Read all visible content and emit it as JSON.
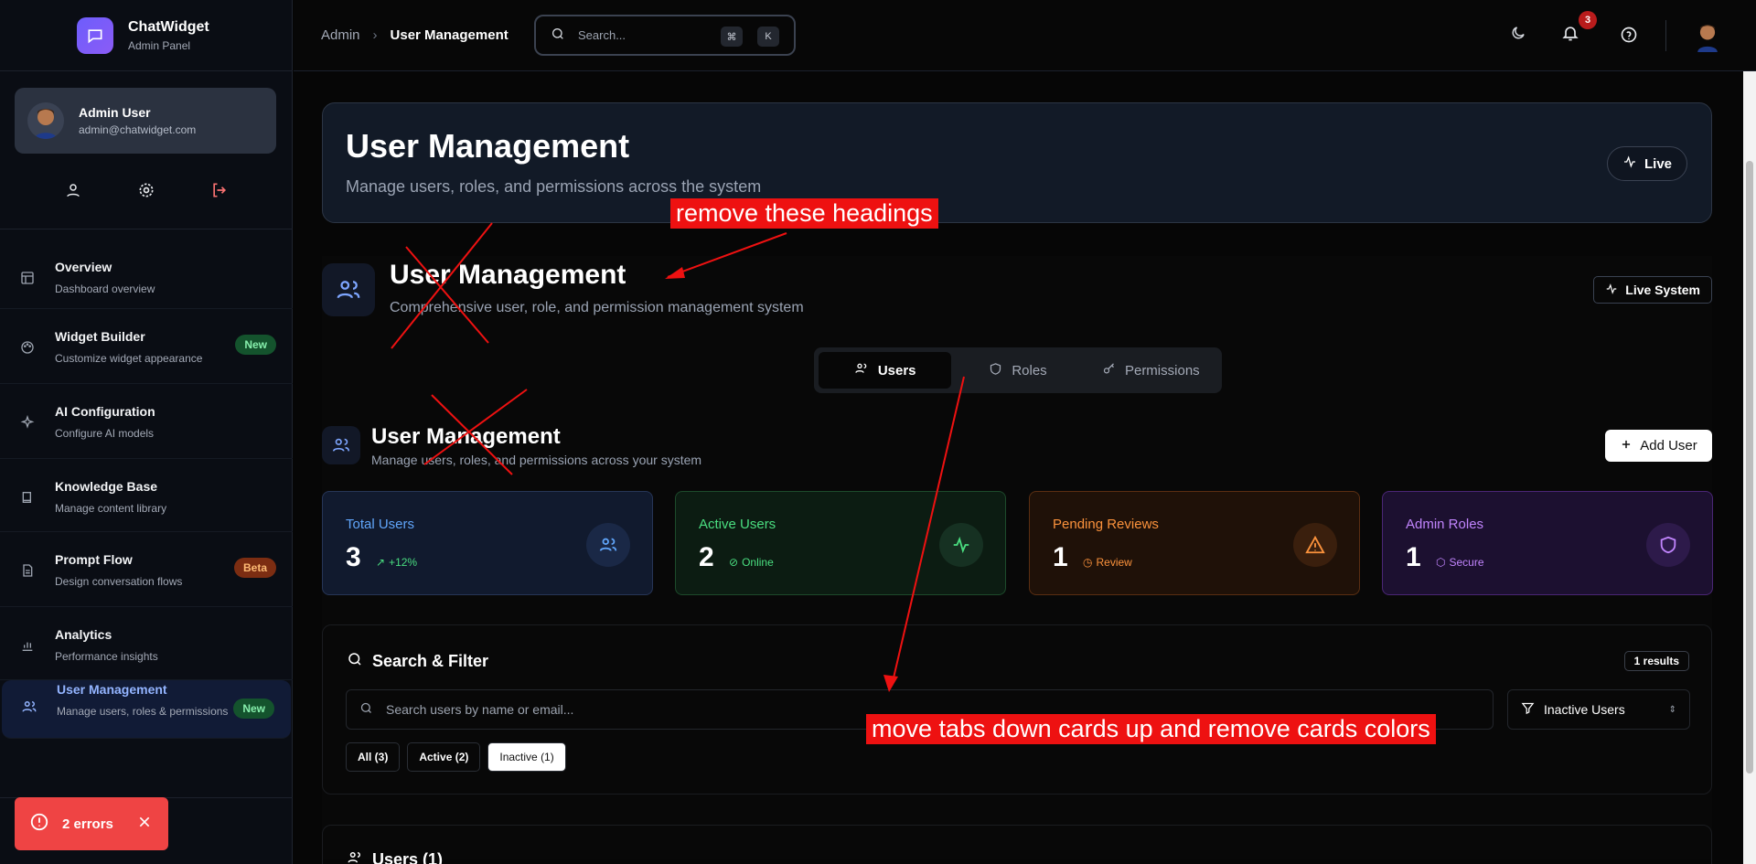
{
  "brand": {
    "name": "ChatWidget",
    "subtitle": "Admin Panel"
  },
  "user": {
    "name": "Admin User",
    "email": "admin@chatwidget.com"
  },
  "sidebar": {
    "items": [
      {
        "title": "Overview",
        "desc": "Dashboard overview",
        "icon": "layout-icon"
      },
      {
        "title": "Widget Builder",
        "desc": "Customize widget appearance",
        "badge": "New",
        "icon": "palette-icon"
      },
      {
        "title": "AI Configuration",
        "desc": "Configure AI models",
        "icon": "sparkles-icon"
      },
      {
        "title": "Knowledge Base",
        "desc": "Manage content library",
        "icon": "book-icon"
      },
      {
        "title": "Prompt Flow",
        "desc": "Design conversation flows",
        "badge": "Beta",
        "icon": "file-text-icon"
      },
      {
        "title": "Analytics",
        "desc": "Performance insights",
        "icon": "bar-chart-icon"
      },
      {
        "title": "User Management",
        "desc": "Manage users, roles & permissions",
        "badge": "New",
        "icon": "users-icon"
      }
    ]
  },
  "errors": {
    "label": "2 errors"
  },
  "topbar": {
    "breadcrumb": [
      "Admin",
      "User Management"
    ],
    "search_placeholder": "Search...",
    "kbd": [
      "⌘",
      "K"
    ],
    "notifications": "3"
  },
  "hero": {
    "title": "User Management",
    "subtitle": "Manage users, roles, and permissions across the system",
    "live": "Live"
  },
  "section2": {
    "title": "User Management",
    "subtitle": "Comprehensive user, role, and permission management system",
    "live": "Live System"
  },
  "tabs": [
    {
      "label": "Users",
      "active": true
    },
    {
      "label": "Roles"
    },
    {
      "label": "Permissions"
    }
  ],
  "um": {
    "title": "User Management",
    "subtitle": "Manage users, roles, and permissions across your system",
    "add": "Add User"
  },
  "stats": [
    {
      "label": "Total Users",
      "value": "3",
      "sub": "+12%",
      "color": "#60a5fa"
    },
    {
      "label": "Active Users",
      "value": "2",
      "sub": "Online",
      "color": "#4ade80"
    },
    {
      "label": "Pending Reviews",
      "value": "1",
      "sub": "Review",
      "color": "#fb923c"
    },
    {
      "label": "Admin Roles",
      "value": "1",
      "sub": "Secure",
      "color": "#c084fc"
    }
  ],
  "filter": {
    "title": "Search & Filter",
    "results": "1 results",
    "search_placeholder": "Search users by name or email...",
    "select_value": "Inactive Users",
    "chips": [
      "All (3)",
      "Active (2)",
      "Inactive (1)"
    ]
  },
  "users_panel": {
    "title": "Users (1)"
  },
  "annotations": {
    "a1": "remove these headings",
    "a2": "move tabs down cards up and remove cards colors"
  }
}
